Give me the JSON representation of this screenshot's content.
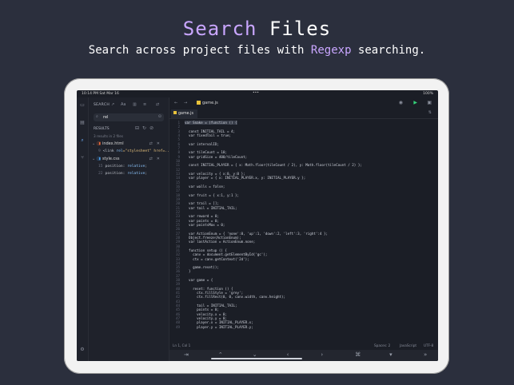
{
  "hero": {
    "title_accent": "Search",
    "title_rest": " Files",
    "subtitle_pre": "Search across project files with ",
    "subtitle_accent": "Regexp",
    "subtitle_post": " searching."
  },
  "statusbar": {
    "time": "10:14 PM   Sat Mar 16",
    "dots": "•••",
    "battery": "100%"
  },
  "sidebar": {
    "header": "SEARCH",
    "query": "rel",
    "results_label": "RESULTS",
    "summary": "3 results in 2 files",
    "files": [
      {
        "name": "index.html",
        "matches": [
          {
            "line": "9",
            "pre": "<link ",
            "hit": "rel",
            "post": "=\"stylesheet\" href=..."
          }
        ]
      },
      {
        "name": "style.css",
        "matches": [
          {
            "line": "15",
            "pre": "position: ",
            "hit": "relative",
            "post": ";"
          },
          {
            "line": "22",
            "pre": "position: ",
            "hit": "relative",
            "post": ";"
          }
        ]
      }
    ]
  },
  "editor": {
    "filename": "game.js",
    "tab": "game.js",
    "status": {
      "position": "Ln 1, Col 1",
      "spaces": "Spaces: 2",
      "language": "JavaScript",
      "encoding": "UTF-8"
    },
    "lines": [
      "var Snake = (function () {",
      "",
      "  const INITIAL_TAIL = 4;",
      "  var fixedTail = true;",
      "",
      "  var intervalID;",
      "",
      "  var tileCount = 10;",
      "  var gridSize = 400/tileCount;",
      "",
      "  const INITIAL_PLAYER = { x: Math.floor(tileCount / 2), y: Math.floor(tileCount / 2) };",
      "",
      "  var velocity = { x:0, y:0 };",
      "  var player = { x: INITIAL_PLAYER.x, y: INITIAL_PLAYER.y };",
      "",
      "  var walls = false;",
      "",
      "  var fruit = { x:1, y:1 };",
      "",
      "  var trail = [];",
      "  var tail = INITIAL_TAIL;",
      "",
      "  var reward = 0;",
      "  var points = 0;",
      "  var pointsMax = 0;",
      "",
      "  var ActionEnum = { 'none':0, 'up':1, 'down':2, 'left':3, 'right':4 };",
      "  Object.freeze(ActionEnum);",
      "  var lastAction = ActionEnum.none;",
      "",
      "  function setup () {",
      "    canv = document.getElementById('gc');",
      "    ctx = canv.getContext('2d');",
      "",
      "    game.reset();",
      "  }",
      "",
      "  var game = {",
      "",
      "    reset: function () {",
      "      ctx.fillStyle = 'grey';",
      "      ctx.fillRect(0, 0, canv.width, canv.height);",
      "",
      "      tail = INITIAL_TAIL;",
      "      points = 0;",
      "      velocity.x = 0;",
      "      velocity.y = 0;",
      "      player.x = INITIAL_PLAYER.x;",
      "      player.y = INITIAL_PLAYER.y;"
    ]
  },
  "keys": [
    "⇥",
    "⌃",
    "⌄",
    "‹",
    "›",
    "⌘",
    "▾",
    "»"
  ],
  "icons": {
    "rail": [
      "folder-icon",
      "files-icon",
      "search-icon",
      "source-control-icon",
      "settings-icon"
    ],
    "colors": {
      "accent": "#c9a6ff",
      "run": "#34d27a",
      "js": "#e8c23a",
      "html": "#e96a3b",
      "css": "#4a9de8"
    }
  }
}
